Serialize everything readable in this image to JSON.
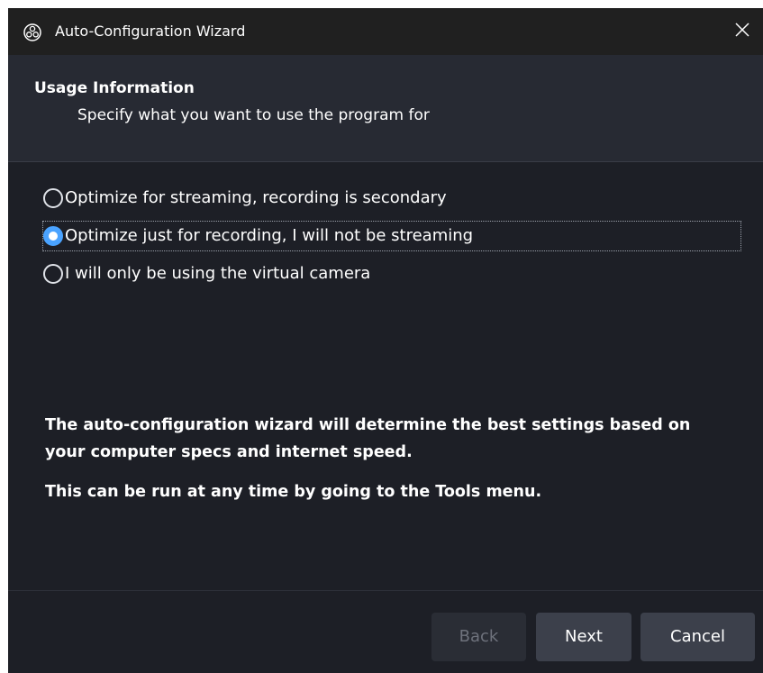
{
  "window": {
    "title": "Auto-Configuration Wizard",
    "app_icon": "obs-logo-icon",
    "close_icon": "close-icon"
  },
  "header": {
    "title": "Usage Information",
    "subtitle": "Specify what you want to use the program for"
  },
  "options": [
    {
      "label": "Optimize for streaming, recording is secondary",
      "checked": false
    },
    {
      "label": "Optimize just for recording, I will not be streaming",
      "checked": true
    },
    {
      "label": "I will only be using the virtual camera",
      "checked": false
    }
  ],
  "info": {
    "line1": "The auto-configuration wizard will determine the best settings based on your computer specs and internet speed.",
    "line2": "This can be run at any time by going to the Tools menu."
  },
  "buttons": {
    "back": "Back",
    "next": "Next",
    "cancel": "Cancel"
  },
  "colors": {
    "accent": "#4aa3ff",
    "background": "#1d1f26",
    "header_background": "#272a33"
  }
}
